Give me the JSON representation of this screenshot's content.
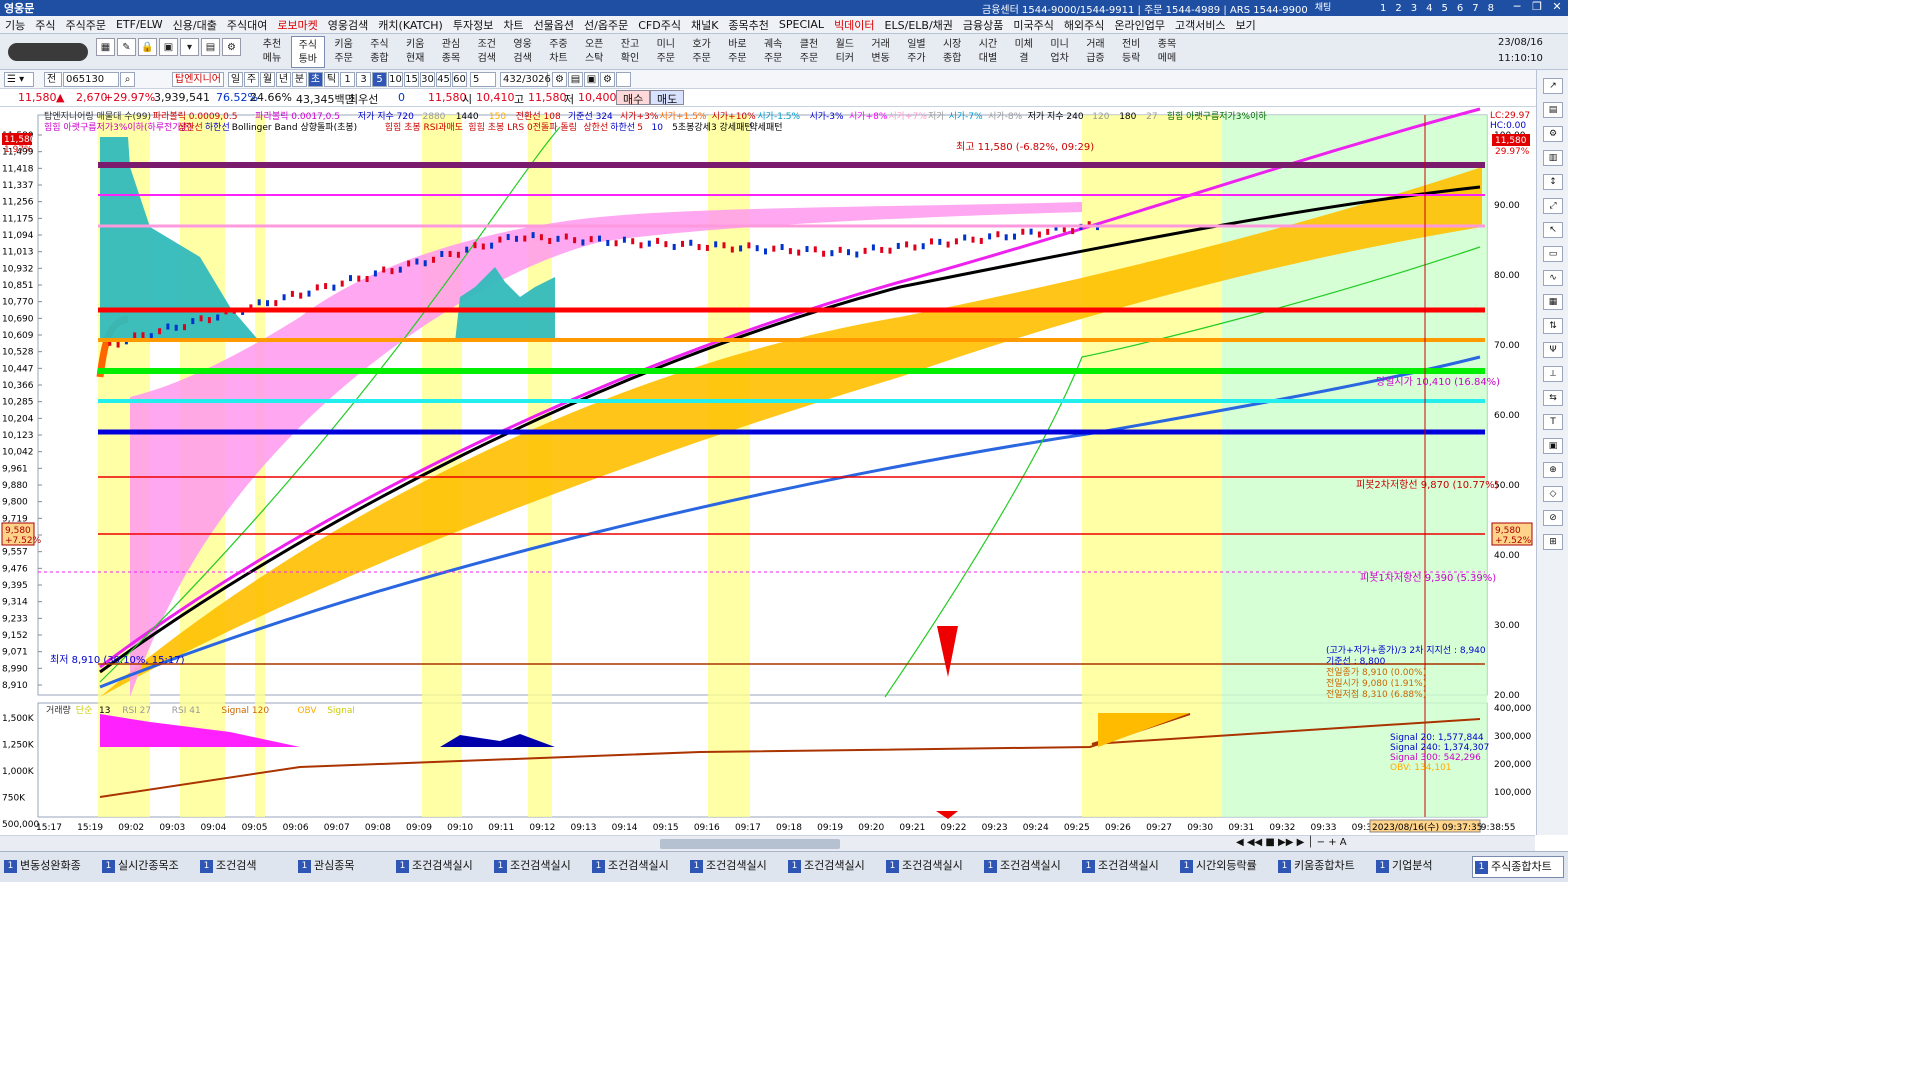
{
  "titlebar": {
    "app_name": "영웅문",
    "info": "금융센터 1544-9000/1544-9911 | 주문 1544-4989 | ARS 1544-9900",
    "chat_label": "채팅",
    "pages": [
      "1",
      "2",
      "3",
      "4",
      "5",
      "6",
      "7",
      "8"
    ]
  },
  "menu": [
    "기능",
    "주식",
    "주식주문",
    "ETF/ELW",
    "신용/대출",
    "주식대여",
    "로보마켓",
    "영웅검색",
    "캐치(KATCH)",
    "투자정보",
    "차트",
    "선물옵션",
    "선/옵주문",
    "CFD주식",
    "채널K",
    "종목추천",
    "SPECIAL",
    "빅데이터",
    "ELS/ELB/채권",
    "금융상품",
    "미국주식",
    "해외주식",
    "온라인업무",
    "고객서비스",
    "보기"
  ],
  "toolbar": {
    "buttons": [
      {
        "l1": "추천",
        "l2": "메뉴"
      },
      {
        "l1": "주식",
        "l2": "통바"
      },
      {
        "l1": "키움",
        "l2": "주문"
      },
      {
        "l1": "주식",
        "l2": "종합"
      },
      {
        "l1": "키움",
        "l2": "현재"
      },
      {
        "l1": "관심",
        "l2": "종목"
      },
      {
        "l1": "조건",
        "l2": "검색"
      },
      {
        "l1": "영웅",
        "l2": "검색"
      },
      {
        "l1": "주중",
        "l2": "차트"
      },
      {
        "l1": "오픈",
        "l2": "스탁"
      },
      {
        "l1": "잔고",
        "l2": "확인"
      },
      {
        "l1": "미니",
        "l2": "주문"
      },
      {
        "l1": "호가",
        "l2": "주문"
      },
      {
        "l1": "바로",
        "l2": "주문"
      },
      {
        "l1": "궤속",
        "l2": "주문"
      },
      {
        "l1": "클천",
        "l2": "주문"
      },
      {
        "l1": "월드",
        "l2": "티커"
      },
      {
        "l1": "거래",
        "l2": "변동"
      },
      {
        "l1": "일별",
        "l2": "주가"
      },
      {
        "l1": "시장",
        "l2": "종합"
      },
      {
        "l1": "시간",
        "l2": "대별"
      },
      {
        "l1": "미체",
        "l2": "결"
      },
      {
        "l1": "미니",
        "l2": "업차"
      },
      {
        "l1": "거래",
        "l2": "급증"
      },
      {
        "l1": "전비",
        "l2": "등락"
      },
      {
        "l1": "종목",
        "l2": "메메"
      }
    ],
    "date": "23/08/16",
    "time": "11:10:10"
  },
  "controls": {
    "code": "065130",
    "name": "탑엔지니어",
    "periods": [
      "일",
      "주",
      "월",
      "년",
      "분",
      "초",
      "틱"
    ],
    "intervals": [
      "1",
      "3",
      "5",
      "10",
      "15",
      "30",
      "45",
      "60"
    ],
    "count": "5",
    "range": "432/3026"
  },
  "quote": {
    "price": "11,580",
    "change": "2,670",
    "change_pct": "+29.97%",
    "volume": "3,939,541",
    "ratio1": "76.52%",
    "ratio2": "24.66%",
    "amount": "43,345백만",
    "priority_label": "최우선",
    "priority_val": "0",
    "last": "11,580",
    "open_label": "시",
    "open": "10,410",
    "high_label": "고",
    "high": "11,580",
    "low_label": "저",
    "low": "10,400",
    "buy_label": "매수",
    "sell_label": "매도"
  },
  "chart": {
    "legend1": [
      "탑엔지니어링 매물대 수(99)",
      "파라볼릭 0.0009,0.5",
      "파라볼릭 0.0017,0.5",
      "저가 지수 720",
      "2880",
      "1440",
      "150",
      "전환선 108",
      "기준선 324",
      "시가+3%",
      "시가+1.5%",
      "시가+10%",
      "시가-1.5%",
      "시가-3%",
      "시가+8%",
      "시가+7%",
      "저가",
      "시가-7%",
      "시가-8%",
      "저가 지수 240",
      "120",
      "180",
      "27",
      "힘힘 아랫구름저가3%이하"
    ],
    "legend2": [
      "힘힘 아랫구름저가3%이하(하루전기준)",
      "상한선",
      "하한선",
      "Bollinger Band 상향돌파(초봉)",
      "힘힘 초봉 RSI과매도",
      "힘힘 초봉 LRS 0전돌파 돌림",
      "상한선",
      "하한선",
      "5",
      "10",
      "5초봉강세3 강세패턴",
      "약세패턴"
    ],
    "left_axis": [
      "11,580",
      "11,499",
      "11,418",
      "11,337",
      "11,256",
      "11,175",
      "11,094",
      "11,013",
      "10,932",
      "10,851",
      "10,770",
      "10,690",
      "10,609",
      "10,528",
      "10,447",
      "10,366",
      "10,285",
      "10,204",
      "10,123",
      "10,042",
      "9,961",
      "9,880",
      "9,800",
      "9,719",
      "9,638",
      "9,557",
      "9,476",
      "9,395",
      "9,314",
      "9,233",
      "9,152",
      "9,071",
      "8,990",
      "8,910"
    ],
    "right_axis": [
      "100.00",
      "90.00",
      "80.00",
      "70.00",
      "60.00",
      "50.00",
      "40.00",
      "30.00",
      "20.00"
    ],
    "right_top": [
      "LC:29.97",
      "HC:0.00"
    ],
    "price_tag_left_top": "11,580",
    "price_tag_left_pct": "1.97%",
    "price_tag_left": [
      "9,580",
      "+7.52%"
    ],
    "price_tag_right": [
      "9,580",
      "+7.52%"
    ],
    "price_tag_right_top": [
      "11,580",
      "29.97%"
    ],
    "ann_high": "최고 11,580 (-6.82%, 09:29)",
    "ann_low": "최저 8,910 (30.10%, 15:17)",
    "ann_open": "당일시가 10,410 (16.84%)",
    "ann_pivot2": "피봇2차저항선 9,870 (10.77%)",
    "ann_pivot1": "피봇1차저항선 9,390 (5.39%)",
    "ann_lines": [
      "(고가+저가+종가)/3 2차 지지선 : 8,940",
      "기준선 : 8,800",
      "전일종가 8,910 (0.00%)",
      "전일시가 9,080 (1.91%)",
      "전일저점 8,310 (6.88%)"
    ],
    "sub_legend": [
      "거래량",
      "단순",
      "13",
      "RSI 27",
      "RSI 41",
      "Signal 120",
      "OBV",
      "Signal"
    ],
    "sub_left_axis": [
      "1,500K",
      "1,250K",
      "1,000K",
      "750K",
      "500,000"
    ],
    "sub_right_axis": [
      "400,000",
      "300,000",
      "200,000",
      "100,000"
    ],
    "sub_signals": [
      "Signal 20: 1,577,844",
      "Signal 240: 1,374,307",
      "Signal 300: 542,296",
      "OBV: 134,101"
    ],
    "time_axis": [
      "15:17",
      "15:19",
      "09:02",
      "09:03",
      "09:04",
      "09:05",
      "09:06",
      "09:07",
      "09:08",
      "09:09",
      "09:10",
      "09:11",
      "09:12",
      "09:13",
      "09:14",
      "09:15",
      "09:16",
      "09:17",
      "09:18",
      "09:19",
      "09:20",
      "09:21",
      "09:22",
      "09:23",
      "09:24",
      "09:25",
      "09:26",
      "09:27",
      "09:30",
      "09:31",
      "09:32",
      "09:33",
      "09:34",
      "09:35",
      "09:36",
      "09:38:55"
    ],
    "cursor_time": "2023/08/16(수) 09:37:35"
  },
  "taskbar": [
    "변동성완화종",
    "실시간종목조",
    "조건검색",
    "관심종목",
    "조건검색실시",
    "조건검색실시",
    "조건검색실시",
    "조건검색실시",
    "조건검색실시",
    "조건검색실시",
    "조건검색실시",
    "조건검색실시",
    "시간외등락률",
    "키움종합차트",
    "기업분석",
    "주식종합차트"
  ],
  "colors": {
    "title": "#1e4fa3",
    "up": "#e0001b",
    "down": "#0033cc",
    "bollinger": "#ffc000",
    "envelope": "#ff99ee",
    "volume_fill": "#33bbbb",
    "highlight_band": "#ffff88",
    "green_band": "#ccffcc"
  }
}
